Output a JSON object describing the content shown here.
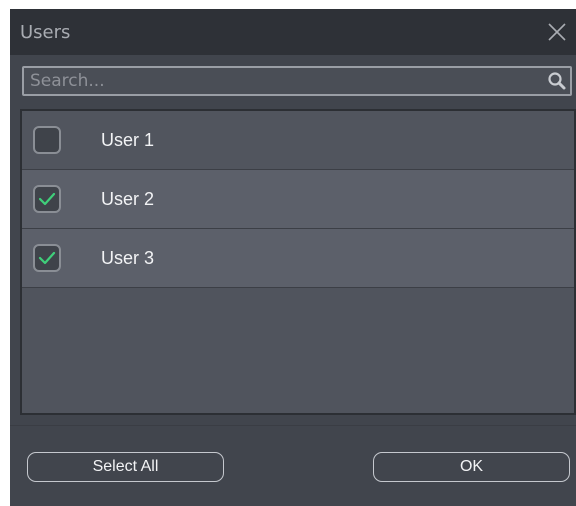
{
  "dialog": {
    "title": "Users",
    "close_icon": "close-icon"
  },
  "search": {
    "placeholder": "Search...",
    "value": "",
    "icon": "search-icon"
  },
  "users": [
    {
      "label": "User 1",
      "checked": false
    },
    {
      "label": "User 2",
      "checked": true
    },
    {
      "label": "User 3",
      "checked": true
    }
  ],
  "footer": {
    "select_all_label": "Select All",
    "ok_label": "OK"
  },
  "colors": {
    "check_accent": "#3fcf7a",
    "background": "#41454d",
    "titlebar": "#2e3137"
  }
}
